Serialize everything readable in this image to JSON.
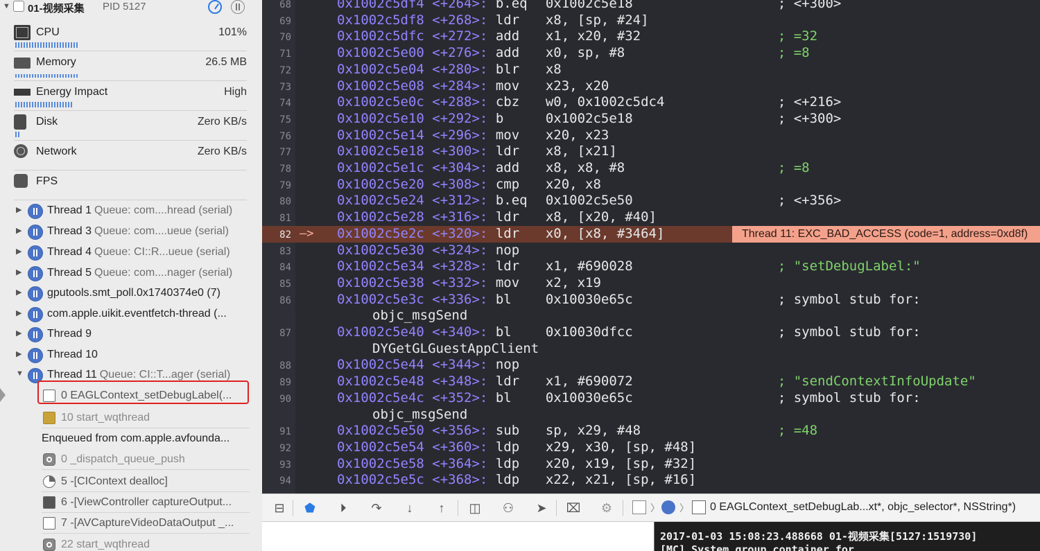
{
  "process": {
    "name": "01-视频采集",
    "pid": "PID 5127"
  },
  "gauges": [
    {
      "label": "CPU",
      "value": "101%"
    },
    {
      "label": "Memory",
      "value": "26.5 MB"
    },
    {
      "label": "Energy Impact",
      "value": "High"
    },
    {
      "label": "Disk",
      "value": "Zero KB/s"
    },
    {
      "label": "Network",
      "value": "Zero KB/s"
    },
    {
      "label": "FPS",
      "value": ""
    }
  ],
  "threads": [
    {
      "name": "Thread 1",
      "queue": "Queue: com....hread (serial)"
    },
    {
      "name": "Thread 3",
      "queue": "Queue: com....ueue (serial)"
    },
    {
      "name": "Thread 4",
      "queue": "Queue: CI::R...ueue (serial)"
    },
    {
      "name": "Thread 5",
      "queue": "Queue: com....nager (serial)"
    },
    {
      "name": "gputools.smt_poll.0x1740374e0 (7)",
      "queue": ""
    },
    {
      "name": "com.apple.uikit.eventfetch-thread (...",
      "queue": ""
    },
    {
      "name": "Thread 9",
      "queue": ""
    },
    {
      "name": "Thread 10",
      "queue": ""
    },
    {
      "name": "Thread 11",
      "queue": "Queue: CI::T...ager (serial)"
    }
  ],
  "frames": [
    {
      "label": "0 EAGLContext_setDebugLabel(..."
    },
    {
      "label": "10 start_wqthread"
    },
    {
      "label": "Enqueued from com.apple.avfounda..."
    },
    {
      "label": "0 _dispatch_queue_push"
    },
    {
      "label": "5 -[CIContext dealloc]"
    },
    {
      "label": "6 -[ViewController captureOutput..."
    },
    {
      "label": "7 -[AVCaptureVideoDataOutput _..."
    },
    {
      "label": "22 start_wqthread"
    }
  ],
  "disassembly": {
    "pc_marker": "—>",
    "exception": "Thread 11: EXC_BAD_ACCESS (code=1, address=0xd8f)",
    "lines": [
      {
        "n": "68",
        "addr": "0x1002c5df4",
        "off": "<+264>:",
        "op": "b.eq",
        "args": "0x1002c5e18",
        "cmt": "; <+300>"
      },
      {
        "n": "69",
        "addr": "0x1002c5df8",
        "off": "<+268>:",
        "op": "ldr",
        "args": "x8, [sp, #24]",
        "cmt": ""
      },
      {
        "n": "70",
        "addr": "0x1002c5dfc",
        "off": "<+272>:",
        "op": "add",
        "args": "x1, x20, #32",
        "cmt": "; =32"
      },
      {
        "n": "71",
        "addr": "0x1002c5e00",
        "off": "<+276>:",
        "op": "add",
        "args": "x0, sp, #8",
        "cmt": "; =8"
      },
      {
        "n": "72",
        "addr": "0x1002c5e04",
        "off": "<+280>:",
        "op": "blr",
        "args": "x8",
        "cmt": ""
      },
      {
        "n": "73",
        "addr": "0x1002c5e08",
        "off": "<+284>:",
        "op": "mov",
        "args": "x23, x20",
        "cmt": ""
      },
      {
        "n": "74",
        "addr": "0x1002c5e0c",
        "off": "<+288>:",
        "op": "cbz",
        "args": "w0, 0x1002c5dc4",
        "cmt": "; <+216>"
      },
      {
        "n": "75",
        "addr": "0x1002c5e10",
        "off": "<+292>:",
        "op": "b",
        "args": "0x1002c5e18",
        "cmt": "; <+300>"
      },
      {
        "n": "76",
        "addr": "0x1002c5e14",
        "off": "<+296>:",
        "op": "mov",
        "args": "x20, x23",
        "cmt": ""
      },
      {
        "n": "77",
        "addr": "0x1002c5e18",
        "off": "<+300>:",
        "op": "ldr",
        "args": "x8, [x21]",
        "cmt": ""
      },
      {
        "n": "78",
        "addr": "0x1002c5e1c",
        "off": "<+304>:",
        "op": "add",
        "args": "x8, x8, #8",
        "cmt": "; =8"
      },
      {
        "n": "79",
        "addr": "0x1002c5e20",
        "off": "<+308>:",
        "op": "cmp",
        "args": "x20, x8",
        "cmt": ""
      },
      {
        "n": "80",
        "addr": "0x1002c5e24",
        "off": "<+312>:",
        "op": "b.eq",
        "args": "0x1002c5e50",
        "cmt": "; <+356>"
      },
      {
        "n": "81",
        "addr": "0x1002c5e28",
        "off": "<+316>:",
        "op": "ldr",
        "args": "x8, [x20, #40]",
        "cmt": ""
      },
      {
        "n": "82",
        "addr": "0x1002c5e2c",
        "off": "<+320>:",
        "op": "ldr",
        "args": "x0, [x8, #3464]",
        "cmt": ""
      },
      {
        "n": "83",
        "addr": "0x1002c5e30",
        "off": "<+324>:",
        "op": "nop",
        "args": "",
        "cmt": ""
      },
      {
        "n": "84",
        "addr": "0x1002c5e34",
        "off": "<+328>:",
        "op": "ldr",
        "args": "x1, #690028",
        "cmt": "; \"setDebugLabel:\""
      },
      {
        "n": "85",
        "addr": "0x1002c5e38",
        "off": "<+332>:",
        "op": "mov",
        "args": "x2, x19",
        "cmt": ""
      },
      {
        "n": "86",
        "addr": "0x1002c5e3c",
        "off": "<+336>:",
        "op": "bl",
        "args": "0x10030e65c",
        "cmt": "; symbol stub for:",
        "cont": "objc_msgSend"
      },
      {
        "n": "87",
        "addr": "0x1002c5e40",
        "off": "<+340>:",
        "op": "bl",
        "args": "0x10030dfcc",
        "cmt": "; symbol stub for:",
        "cont": "DYGetGLGuestAppClient"
      },
      {
        "n": "88",
        "addr": "0x1002c5e44",
        "off": "<+344>:",
        "op": "nop",
        "args": "",
        "cmt": ""
      },
      {
        "n": "89",
        "addr": "0x1002c5e48",
        "off": "<+348>:",
        "op": "ldr",
        "args": "x1, #690072",
        "cmt": "; \"sendContextInfoUpdate\""
      },
      {
        "n": "90",
        "addr": "0x1002c5e4c",
        "off": "<+352>:",
        "op": "bl",
        "args": "0x10030e65c",
        "cmt": "; symbol stub for:",
        "cont": "objc_msgSend"
      },
      {
        "n": "91",
        "addr": "0x1002c5e50",
        "off": "<+356>:",
        "op": "sub",
        "args": "sp, x29, #48",
        "cmt": "; =48"
      },
      {
        "n": "92",
        "addr": "0x1002c5e54",
        "off": "<+360>:",
        "op": "ldp",
        "args": "x29, x30, [sp, #48]",
        "cmt": ""
      },
      {
        "n": "93",
        "addr": "0x1002c5e58",
        "off": "<+364>:",
        "op": "ldp",
        "args": "x20, x19, [sp, #32]",
        "cmt": ""
      },
      {
        "n": "94",
        "addr": "0x1002c5e5c",
        "off": "<+368>:",
        "op": "ldp",
        "args": "x22, x21, [sp, #16]",
        "cmt": ""
      }
    ]
  },
  "debugbar": {
    "breadcrumb": "0 EAGLContext_setDebugLab...xt*, objc_selector*, NSString*)"
  },
  "console": {
    "lines": [
      "2017-01-03 15:08:23.488668 01-视频采集[5127:1519730]",
      "[MC] System group container for"
    ]
  },
  "colors": {
    "accent": "#2c7be5",
    "editor_bg": "#292a30",
    "address": "#9184ff",
    "comment": "#7fd36a",
    "current_line": "#6b3a2c",
    "exception_badge": "#f4a18b",
    "highlight_box": "#e02020"
  }
}
